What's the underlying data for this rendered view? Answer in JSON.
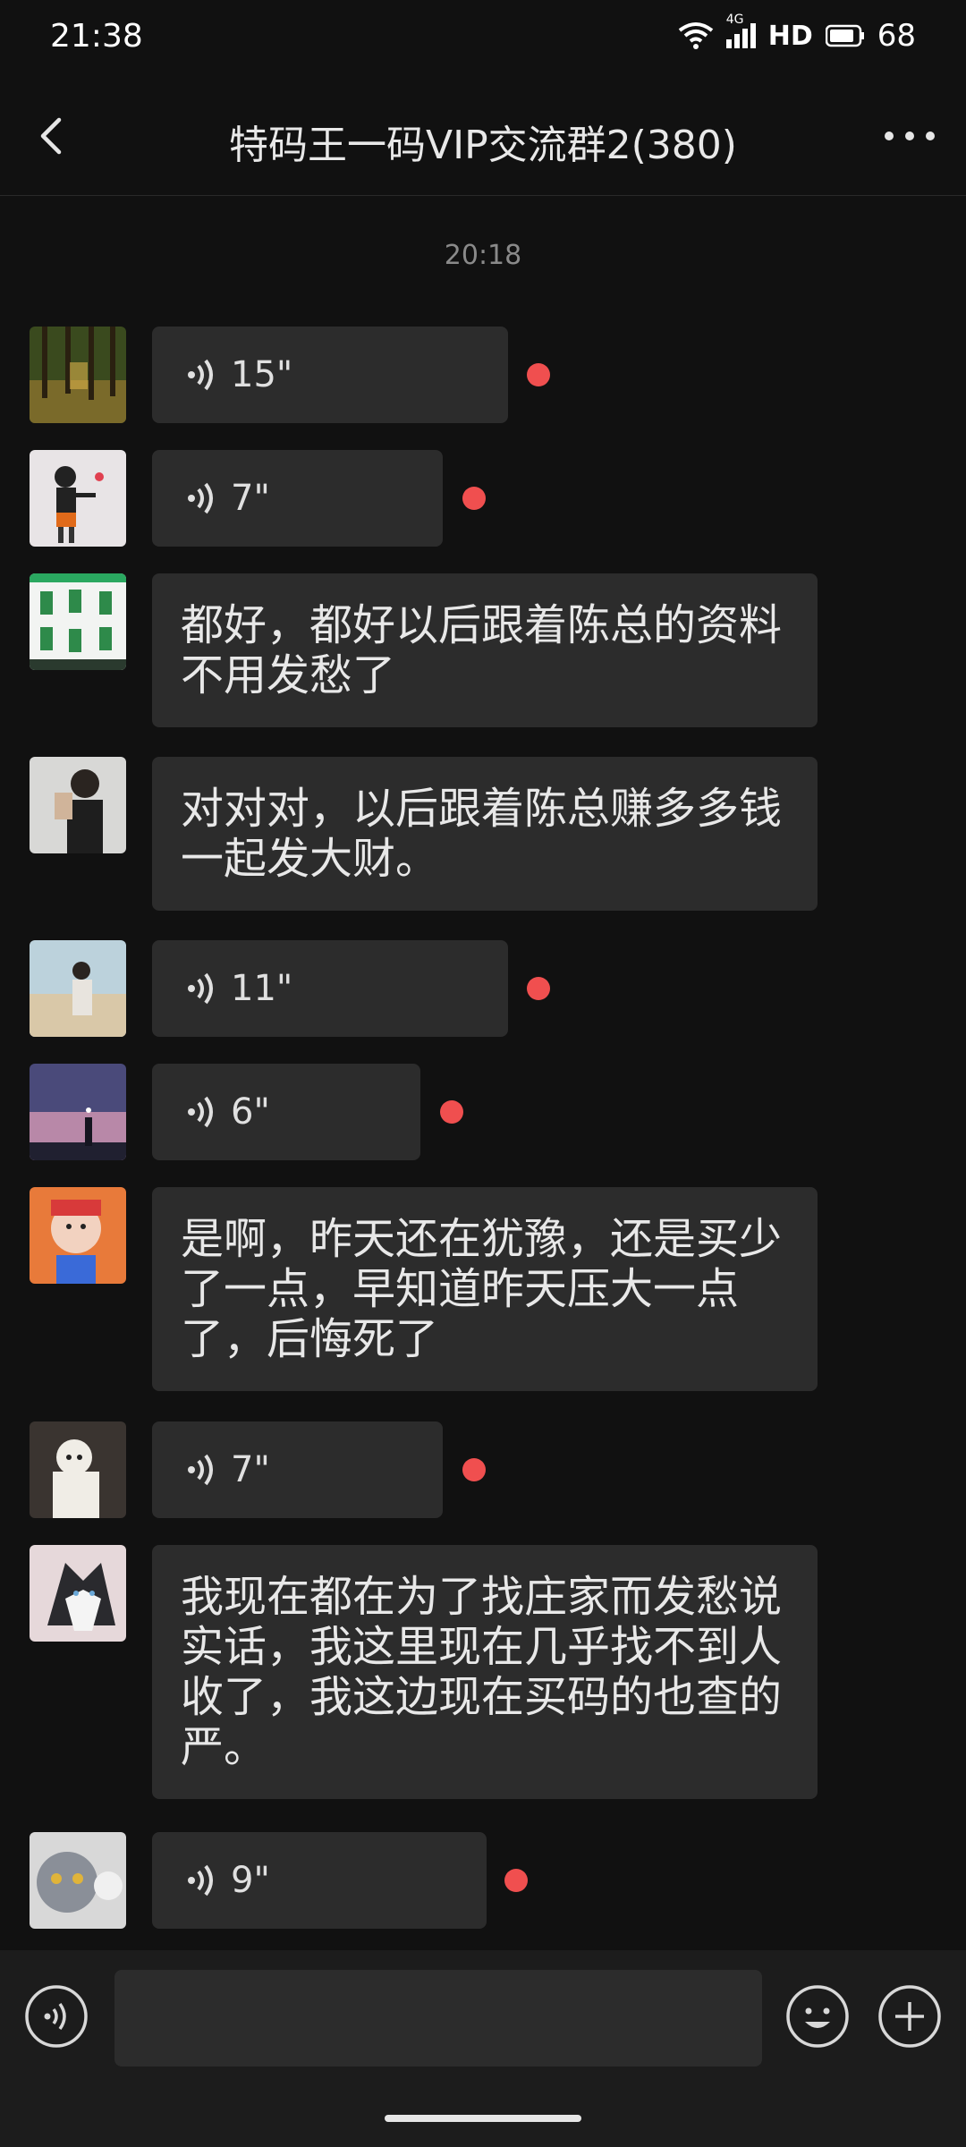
{
  "status": {
    "time": "21:38",
    "network": "4G",
    "hd": "HD",
    "battery": "68"
  },
  "nav": {
    "title": "特码王一码VIP交流群2(380)"
  },
  "timestamp": "20:18",
  "messages": [
    {
      "kind": "voice",
      "duration": "15\"",
      "unread": true
    },
    {
      "kind": "voice",
      "duration": "7\"",
      "unread": true
    },
    {
      "kind": "text",
      "text": "都好，都好以后跟着陈总的资料不用发愁了"
    },
    {
      "kind": "text",
      "text": "对对对，以后跟着陈总赚多多钱一起发大财。"
    },
    {
      "kind": "voice",
      "duration": "11\"",
      "unread": true
    },
    {
      "kind": "voice",
      "duration": "6\"",
      "unread": true
    },
    {
      "kind": "text",
      "text": "是啊，昨天还在犹豫，还是买少了一点，早知道昨天压大一点了，后悔死了"
    },
    {
      "kind": "voice",
      "duration": "7\"",
      "unread": true
    },
    {
      "kind": "text",
      "text": "我现在都在为了找庄家而发愁说实话，我这里现在几乎找不到人收了，我这边现在买码的也查的严。"
    },
    {
      "kind": "voice",
      "duration": "9\"",
      "unread": true
    }
  ],
  "icons": {
    "back": "chevron-left-icon",
    "more": "more-dots-icon",
    "voice": "voice-wave-icon",
    "emoji": "emoji-icon",
    "plus": "plus-icon",
    "wifi": "wifi-icon",
    "signal": "signal-icon",
    "battery": "battery-icon"
  },
  "colors": {
    "background": "#111111",
    "bubble": "#2c2c2c",
    "unread_dot": "#f04f4f",
    "input_bar": "#1c1c1c"
  }
}
